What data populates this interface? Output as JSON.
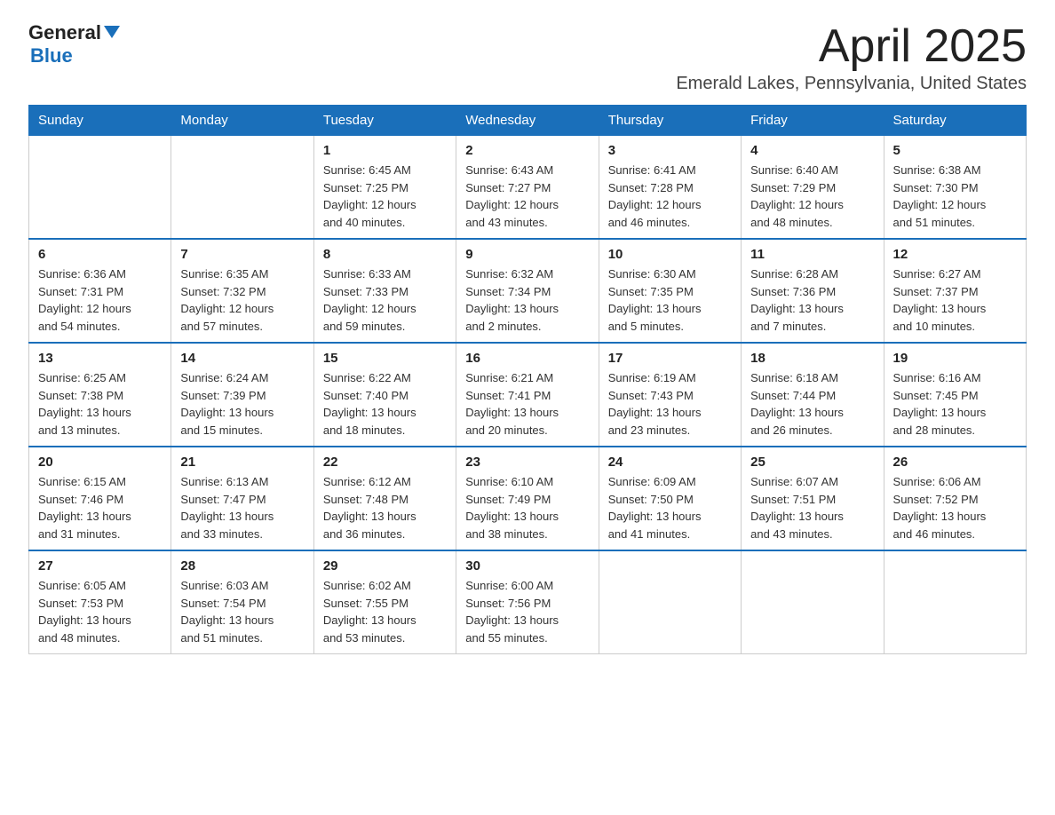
{
  "logo": {
    "general": "General",
    "arrow": "▲",
    "blue": "Blue"
  },
  "title": "April 2025",
  "subtitle": "Emerald Lakes, Pennsylvania, United States",
  "days_of_week": [
    "Sunday",
    "Monday",
    "Tuesday",
    "Wednesday",
    "Thursday",
    "Friday",
    "Saturday"
  ],
  "weeks": [
    [
      {
        "day": "",
        "info": ""
      },
      {
        "day": "",
        "info": ""
      },
      {
        "day": "1",
        "info": "Sunrise: 6:45 AM\nSunset: 7:25 PM\nDaylight: 12 hours\nand 40 minutes."
      },
      {
        "day": "2",
        "info": "Sunrise: 6:43 AM\nSunset: 7:27 PM\nDaylight: 12 hours\nand 43 minutes."
      },
      {
        "day": "3",
        "info": "Sunrise: 6:41 AM\nSunset: 7:28 PM\nDaylight: 12 hours\nand 46 minutes."
      },
      {
        "day": "4",
        "info": "Sunrise: 6:40 AM\nSunset: 7:29 PM\nDaylight: 12 hours\nand 48 minutes."
      },
      {
        "day": "5",
        "info": "Sunrise: 6:38 AM\nSunset: 7:30 PM\nDaylight: 12 hours\nand 51 minutes."
      }
    ],
    [
      {
        "day": "6",
        "info": "Sunrise: 6:36 AM\nSunset: 7:31 PM\nDaylight: 12 hours\nand 54 minutes."
      },
      {
        "day": "7",
        "info": "Sunrise: 6:35 AM\nSunset: 7:32 PM\nDaylight: 12 hours\nand 57 minutes."
      },
      {
        "day": "8",
        "info": "Sunrise: 6:33 AM\nSunset: 7:33 PM\nDaylight: 12 hours\nand 59 minutes."
      },
      {
        "day": "9",
        "info": "Sunrise: 6:32 AM\nSunset: 7:34 PM\nDaylight: 13 hours\nand 2 minutes."
      },
      {
        "day": "10",
        "info": "Sunrise: 6:30 AM\nSunset: 7:35 PM\nDaylight: 13 hours\nand 5 minutes."
      },
      {
        "day": "11",
        "info": "Sunrise: 6:28 AM\nSunset: 7:36 PM\nDaylight: 13 hours\nand 7 minutes."
      },
      {
        "day": "12",
        "info": "Sunrise: 6:27 AM\nSunset: 7:37 PM\nDaylight: 13 hours\nand 10 minutes."
      }
    ],
    [
      {
        "day": "13",
        "info": "Sunrise: 6:25 AM\nSunset: 7:38 PM\nDaylight: 13 hours\nand 13 minutes."
      },
      {
        "day": "14",
        "info": "Sunrise: 6:24 AM\nSunset: 7:39 PM\nDaylight: 13 hours\nand 15 minutes."
      },
      {
        "day": "15",
        "info": "Sunrise: 6:22 AM\nSunset: 7:40 PM\nDaylight: 13 hours\nand 18 minutes."
      },
      {
        "day": "16",
        "info": "Sunrise: 6:21 AM\nSunset: 7:41 PM\nDaylight: 13 hours\nand 20 minutes."
      },
      {
        "day": "17",
        "info": "Sunrise: 6:19 AM\nSunset: 7:43 PM\nDaylight: 13 hours\nand 23 minutes."
      },
      {
        "day": "18",
        "info": "Sunrise: 6:18 AM\nSunset: 7:44 PM\nDaylight: 13 hours\nand 26 minutes."
      },
      {
        "day": "19",
        "info": "Sunrise: 6:16 AM\nSunset: 7:45 PM\nDaylight: 13 hours\nand 28 minutes."
      }
    ],
    [
      {
        "day": "20",
        "info": "Sunrise: 6:15 AM\nSunset: 7:46 PM\nDaylight: 13 hours\nand 31 minutes."
      },
      {
        "day": "21",
        "info": "Sunrise: 6:13 AM\nSunset: 7:47 PM\nDaylight: 13 hours\nand 33 minutes."
      },
      {
        "day": "22",
        "info": "Sunrise: 6:12 AM\nSunset: 7:48 PM\nDaylight: 13 hours\nand 36 minutes."
      },
      {
        "day": "23",
        "info": "Sunrise: 6:10 AM\nSunset: 7:49 PM\nDaylight: 13 hours\nand 38 minutes."
      },
      {
        "day": "24",
        "info": "Sunrise: 6:09 AM\nSunset: 7:50 PM\nDaylight: 13 hours\nand 41 minutes."
      },
      {
        "day": "25",
        "info": "Sunrise: 6:07 AM\nSunset: 7:51 PM\nDaylight: 13 hours\nand 43 minutes."
      },
      {
        "day": "26",
        "info": "Sunrise: 6:06 AM\nSunset: 7:52 PM\nDaylight: 13 hours\nand 46 minutes."
      }
    ],
    [
      {
        "day": "27",
        "info": "Sunrise: 6:05 AM\nSunset: 7:53 PM\nDaylight: 13 hours\nand 48 minutes."
      },
      {
        "day": "28",
        "info": "Sunrise: 6:03 AM\nSunset: 7:54 PM\nDaylight: 13 hours\nand 51 minutes."
      },
      {
        "day": "29",
        "info": "Sunrise: 6:02 AM\nSunset: 7:55 PM\nDaylight: 13 hours\nand 53 minutes."
      },
      {
        "day": "30",
        "info": "Sunrise: 6:00 AM\nSunset: 7:56 PM\nDaylight: 13 hours\nand 55 minutes."
      },
      {
        "day": "",
        "info": ""
      },
      {
        "day": "",
        "info": ""
      },
      {
        "day": "",
        "info": ""
      }
    ]
  ]
}
